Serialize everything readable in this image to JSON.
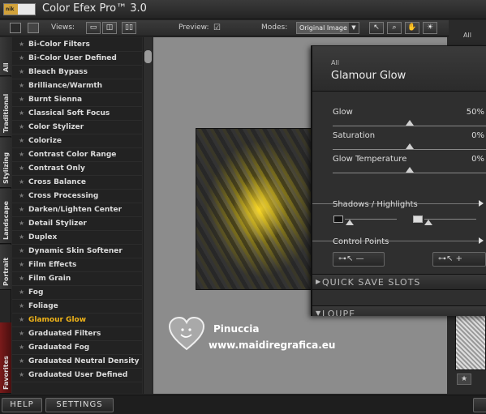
{
  "app": {
    "logo_text": "nik",
    "title": "Color Efex Pro™ 3.0"
  },
  "toolbar": {
    "views_label": "Views:",
    "preview_label": "Preview:",
    "preview_checked": true,
    "modes_label": "Modes:",
    "modes_value": "Original Image"
  },
  "category_tabs": [
    {
      "label": "All"
    },
    {
      "label": "Traditional"
    },
    {
      "label": "Stylizing"
    },
    {
      "label": "Landscape"
    },
    {
      "label": "Portrait"
    },
    {
      "label": "Favorites"
    }
  ],
  "filters": [
    "Bi-Color Filters",
    "Bi-Color User Defined",
    "Bleach Bypass",
    "Brilliance/Warmth",
    "Burnt Sienna",
    "Classical Soft Focus",
    "Color Stylizer",
    "Colorize",
    "Contrast Color Range",
    "Contrast Only",
    "Cross Balance",
    "Cross Processing",
    "Darken/Lighten Center",
    "Detail Stylizer",
    "Duplex",
    "Dynamic Skin Softener",
    "Film Effects",
    "Film Grain",
    "Fog",
    "Foliage",
    "Glamour Glow",
    "Graduated Filters",
    "Graduated Fog",
    "Graduated Neutral Density",
    "Graduated User Defined"
  ],
  "active_filter": "Glamour Glow",
  "active_color": "#f0b419",
  "watermark": {
    "name": "Pinuccia",
    "url": "www.maidiregrafica.eu"
  },
  "right_column": {
    "label": "All"
  },
  "panel": {
    "category": "All",
    "title": "Glamour Glow",
    "sliders": [
      {
        "label": "Glow",
        "value": "50%",
        "level": 0.5
      },
      {
        "label": "Saturation",
        "value": "0%",
        "level": 0.5
      },
      {
        "label": "Glow Temperature",
        "value": "0%",
        "level": 0.5
      }
    ],
    "shadows_highlights": "Shadows / Highlights",
    "control_points": "Control Points",
    "quick_save": "QUICK SAVE SLOTS",
    "loupe": "LOUPE"
  },
  "bottom": {
    "help": "HELP",
    "settings": "SETTINGS"
  }
}
